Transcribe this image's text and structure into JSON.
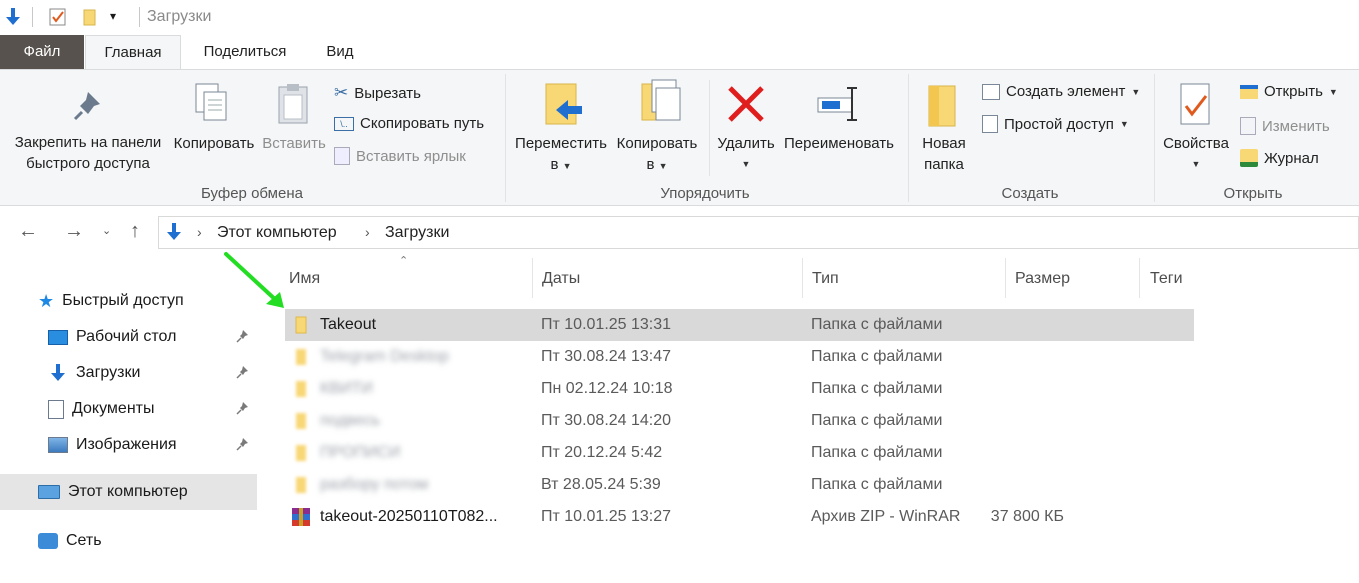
{
  "window": {
    "title": "Загрузки"
  },
  "tabs": {
    "file": "Файл",
    "home": "Главная",
    "share": "Поделиться",
    "view": "Вид"
  },
  "ribbon": {
    "pin_line1": "Закрепить на панели",
    "pin_line2": "быстрого доступа",
    "copy": "Копировать",
    "paste": "Вставить",
    "cut": "Вырезать",
    "copy_path": "Скопировать путь",
    "paste_shortcut": "Вставить ярлык",
    "group_clipboard": "Буфер обмена",
    "move_line1": "Переместить",
    "move_line2": "в",
    "copyto_line1": "Копировать",
    "copyto_line2": "в",
    "delete": "Удалить",
    "rename": "Переименовать",
    "group_organize": "Упорядочить",
    "newfolder_line1": "Новая",
    "newfolder_line2": "папка",
    "new_item": "Создать элемент",
    "easy_access": "Простой доступ",
    "group_new": "Создать",
    "properties": "Свойства",
    "open": "Открыть",
    "edit": "Изменить",
    "history": "Журнал",
    "group_open": "Открыть"
  },
  "address": {
    "root": "Этот компьютер",
    "current": "Загрузки"
  },
  "nav": {
    "quick_access": "Быстрый доступ",
    "desktop": "Рабочий стол",
    "downloads": "Загрузки",
    "documents": "Документы",
    "pictures": "Изображения",
    "this_pc": "Этот компьютер",
    "network": "Сеть"
  },
  "columns": {
    "name": "Имя",
    "date": "Даты",
    "type": "Тип",
    "size": "Размер",
    "tags": "Теги"
  },
  "files": [
    {
      "name": "Takeout",
      "date": "Пт 10.01.25 13:31",
      "type": "Папка с файлами",
      "size": "",
      "icon": "folder-icon",
      "blurred": false,
      "selected": true
    },
    {
      "name": "Telegram Desktop",
      "date": "Пт 30.08.24 13:47",
      "type": "Папка с файлами",
      "size": "",
      "icon": "folder-icon",
      "blurred": true,
      "selected": false
    },
    {
      "name": "КВИТИ",
      "date": "Пн 02.12.24 10:18",
      "type": "Папка с файлами",
      "size": "",
      "icon": "folder-icon",
      "blurred": true,
      "selected": false
    },
    {
      "name": "подвесь",
      "date": "Пт 30.08.24 14:20",
      "type": "Папка с файлами",
      "size": "",
      "icon": "folder-icon",
      "blurred": true,
      "selected": false
    },
    {
      "name": "ПРОПИСИ",
      "date": "Пт 20.12.24 5:42",
      "type": "Папка с файлами",
      "size": "",
      "icon": "folder-icon",
      "blurred": true,
      "selected": false
    },
    {
      "name": "разбору потом",
      "date": "Вт 28.05.24 5:39",
      "type": "Папка с файлами",
      "size": "",
      "icon": "folder-icon",
      "blurred": true,
      "selected": false
    },
    {
      "name": "takeout-20250110T082...",
      "date": "Пт 10.01.25 13:27",
      "type": "Архив ZIP - WinRAR",
      "size": "37 800 КБ",
      "icon": "winrar-archive-icon",
      "blurred": false,
      "selected": false
    }
  ],
  "colors": {
    "file_tab": "#57524d",
    "selection": "#d9d9d9",
    "annotation_arrow": "#22dd22",
    "folder": "#f8d775"
  }
}
